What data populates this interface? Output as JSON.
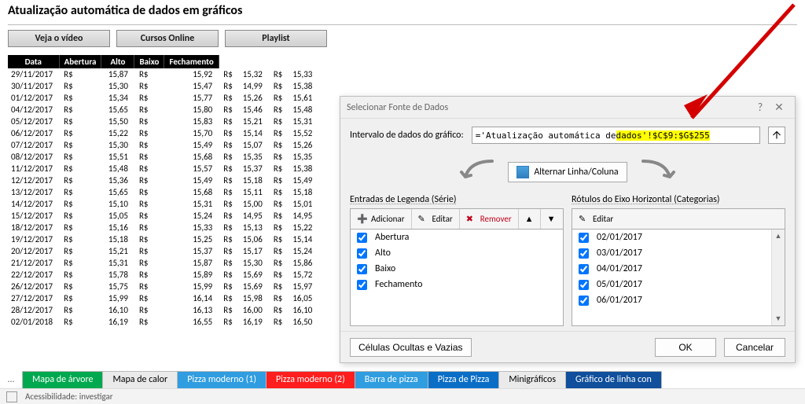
{
  "title": "Atualização automática de dados em gráficos",
  "top_buttons": {
    "video": "Veja o vídeo",
    "cursos": "Cursos Online",
    "playlist": "Playlist"
  },
  "table": {
    "headers": [
      "Data",
      "Abertura",
      "Alto",
      "Baixo",
      "Fechamento"
    ],
    "currency": "R$",
    "rows": [
      {
        "d": "29/11/2017",
        "a": "15,87",
        "h": "15,92",
        "l": "15,32",
        "c": "15,33"
      },
      {
        "d": "30/11/2017",
        "a": "15,30",
        "h": "15,47",
        "l": "14,99",
        "c": "15,38"
      },
      {
        "d": "01/12/2017",
        "a": "15,34",
        "h": "15,77",
        "l": "15,26",
        "c": "15,61"
      },
      {
        "d": "04/12/2017",
        "a": "15,65",
        "h": "15,80",
        "l": "15,46",
        "c": "15,48"
      },
      {
        "d": "05/12/2017",
        "a": "15,50",
        "h": "15,83",
        "l": "15,21",
        "c": "15,31"
      },
      {
        "d": "06/12/2017",
        "a": "15,22",
        "h": "15,70",
        "l": "15,14",
        "c": "15,52"
      },
      {
        "d": "07/12/2017",
        "a": "15,30",
        "h": "15,49",
        "l": "15,07",
        "c": "15,26"
      },
      {
        "d": "08/12/2017",
        "a": "15,51",
        "h": "15,68",
        "l": "15,35",
        "c": "15,35"
      },
      {
        "d": "11/12/2017",
        "a": "15,48",
        "h": "15,57",
        "l": "15,37",
        "c": "15,38"
      },
      {
        "d": "12/12/2017",
        "a": "15,36",
        "h": "15,49",
        "l": "15,18",
        "c": "15,49"
      },
      {
        "d": "13/12/2017",
        "a": "15,65",
        "h": "15,68",
        "l": "15,11",
        "c": "15,18"
      },
      {
        "d": "14/12/2017",
        "a": "15,10",
        "h": "15,31",
        "l": "15,00",
        "c": "15,01"
      },
      {
        "d": "15/12/2017",
        "a": "15,05",
        "h": "15,24",
        "l": "14,95",
        "c": "14,95"
      },
      {
        "d": "18/12/2017",
        "a": "15,16",
        "h": "15,33",
        "l": "15,13",
        "c": "15,22"
      },
      {
        "d": "19/12/2017",
        "a": "15,18",
        "h": "15,25",
        "l": "15,06",
        "c": "15,14"
      },
      {
        "d": "20/12/2017",
        "a": "15,21",
        "h": "15,37",
        "l": "15,17",
        "c": "15,24"
      },
      {
        "d": "21/12/2017",
        "a": "15,31",
        "h": "15,87",
        "l": "15,30",
        "c": "15,86"
      },
      {
        "d": "22/12/2017",
        "a": "15,78",
        "h": "15,89",
        "l": "15,69",
        "c": "15,72"
      },
      {
        "d": "26/12/2017",
        "a": "15,75",
        "h": "15,99",
        "l": "15,69",
        "c": "15,97"
      },
      {
        "d": "27/12/2017",
        "a": "15,99",
        "h": "16,14",
        "l": "15,98",
        "c": "16,05"
      },
      {
        "d": "28/12/2017",
        "a": "16,10",
        "h": "16,13",
        "l": "16,00",
        "c": "16,10"
      },
      {
        "d": "02/01/2018",
        "a": "16,19",
        "h": "16,55",
        "l": "16,19",
        "c": "16,50"
      }
    ]
  },
  "dialog": {
    "title": "Selecionar Fonte de Dados",
    "range_label": "Intervalo de dados do gráfico:",
    "range_prefix": "='Atualização automática de ",
    "range_highlight": "dados'!$C$9:$G$255",
    "switch_btn": "Alternar Linha/Coluna",
    "legend_label": "Entradas de Legenda (Série)",
    "axis_label": "Rótulos do Eixo Horizontal (Categorias)",
    "toolbar": {
      "add": "Adicionar",
      "edit": "Editar",
      "remove": "Remover"
    },
    "series": [
      "Abertura",
      "Alto",
      "Baixo",
      "Fechamento"
    ],
    "categories": [
      "02/01/2017",
      "03/01/2017",
      "04/01/2017",
      "05/01/2017",
      "06/01/2017"
    ],
    "hidden_cells": "Células Ocultas e Vazias",
    "ok": "OK",
    "cancel": "Cancelar"
  },
  "tabs": {
    "items": [
      {
        "label": "Mapa de árvore",
        "cls": "green"
      },
      {
        "label": "Mapa de calor",
        "cls": "gray"
      },
      {
        "label": "Pizza moderno (1)",
        "cls": "lblue"
      },
      {
        "label": "Pizza moderno (2)",
        "cls": "red"
      },
      {
        "label": "Barra de pizza",
        "cls": "lblue"
      },
      {
        "label": "Pizza de Pizza",
        "cls": "blue"
      },
      {
        "label": "Minigráficos",
        "cls": "gray"
      },
      {
        "label": "Gráfico de linha con",
        "cls": "dblue"
      }
    ]
  },
  "statusbar": {
    "acc": "Acessibilidade: investigar"
  }
}
